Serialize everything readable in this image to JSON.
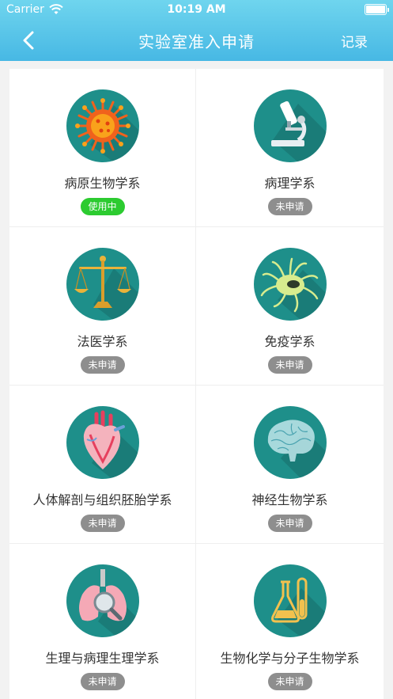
{
  "status_bar": {
    "carrier": "Carrier",
    "time": "10:19 AM"
  },
  "nav": {
    "title": "实验室准入申请",
    "right_link": "记录"
  },
  "labs": [
    {
      "name": "病原生物学系",
      "status": "使用中",
      "icon": "virus-icon",
      "status_color": "#2ccb30"
    },
    {
      "name": "病理学系",
      "status": "未申请",
      "icon": "microscope-icon",
      "status_color": "#8e8e8e"
    },
    {
      "name": "法医学系",
      "status": "未申请",
      "icon": "scales-icon",
      "status_color": "#8e8e8e"
    },
    {
      "name": "免疫学系",
      "status": "未申请",
      "icon": "immune-cell-icon",
      "status_color": "#8e8e8e"
    },
    {
      "name": "人体解剖与组织胚胎学系",
      "status": "未申请",
      "icon": "heart-icon",
      "status_color": "#8e8e8e"
    },
    {
      "name": "神经生物学系",
      "status": "未申请",
      "icon": "brain-icon",
      "status_color": "#8e8e8e"
    },
    {
      "name": "生理与病理生理学系",
      "status": "未申请",
      "icon": "lungs-icon",
      "status_color": "#8e8e8e"
    },
    {
      "name": "生物化学与分子生物学系",
      "status": "未申请",
      "icon": "flask-icon",
      "status_color": "#8e8e8e"
    }
  ],
  "colors": {
    "header_top": "#6fd5ee",
    "header_bottom": "#47b8e4",
    "icon_circle": "#1e8f8a"
  }
}
